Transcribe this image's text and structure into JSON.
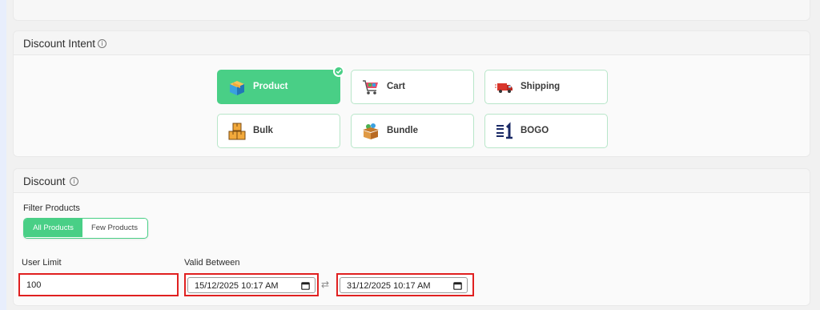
{
  "intent_section": {
    "title": "Discount Intent",
    "info_icon": "info-icon",
    "cards": [
      {
        "label": "Product",
        "icon": "box-icon",
        "selected": true
      },
      {
        "label": "Cart",
        "icon": "shopping-cart-icon",
        "selected": false
      },
      {
        "label": "Shipping",
        "icon": "delivery-truck-icon",
        "selected": false
      },
      {
        "label": "Bulk",
        "icon": "stacked-boxes-icon",
        "selected": false
      },
      {
        "label": "Bundle",
        "icon": "open-box-bundle-icon",
        "selected": false
      },
      {
        "label": "BOGO",
        "icon": "buy-get-one-icon",
        "selected": false
      }
    ]
  },
  "discount_section": {
    "title": "Discount",
    "info_icon": "info-icon",
    "filter_label": "Filter Products",
    "filter_options": [
      "All Products",
      "Few Products"
    ],
    "filter_selected": "All Products",
    "user_limit_label": "User Limit",
    "user_limit_value": "100",
    "valid_between_label": "Valid Between",
    "valid_from": "15/12/2025 10:17 AM",
    "valid_to": "31/12/2025 10:17 AM"
  },
  "colors": {
    "accent": "#49cf86",
    "highlight_border": "#e02020",
    "card_border": "#b8e6c9"
  }
}
